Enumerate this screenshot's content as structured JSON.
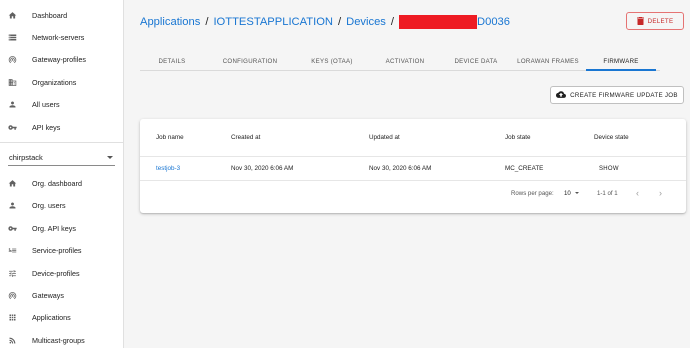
{
  "sidebar": {
    "top_items": [
      {
        "label": "Dashboard",
        "icon": "home-icon"
      },
      {
        "label": "Network-servers",
        "icon": "storage-icon"
      },
      {
        "label": "Gateway-profiles",
        "icon": "wifi-icon"
      },
      {
        "label": "Organizations",
        "icon": "domain-icon"
      },
      {
        "label": "All users",
        "icon": "person-icon"
      },
      {
        "label": "API keys",
        "icon": "key-icon"
      }
    ],
    "org_selector": {
      "value": "chirpstack"
    },
    "org_items": [
      {
        "label": "Org. dashboard",
        "icon": "home-icon"
      },
      {
        "label": "Org. users",
        "icon": "person-icon"
      },
      {
        "label": "Org. API keys",
        "icon": "key-icon"
      },
      {
        "label": "Service-profiles",
        "icon": "account-details-icon"
      },
      {
        "label": "Device-profiles",
        "icon": "tune-icon"
      },
      {
        "label": "Gateways",
        "icon": "wifi-icon"
      },
      {
        "label": "Applications",
        "icon": "apps-icon"
      },
      {
        "label": "Multicast-groups",
        "icon": "rss-icon"
      }
    ]
  },
  "breadcrumb": {
    "applications": "Applications",
    "application_name": "IOTTESTAPPLICATION",
    "devices": "Devices",
    "device_suffix": "D0036",
    "separator": "/"
  },
  "actions": {
    "delete_label": "DELETE",
    "create_fw_label": "CREATE FIRMWARE UPDATE JOB"
  },
  "tabs": [
    {
      "label": "DETAILS"
    },
    {
      "label": "CONFIGURATION"
    },
    {
      "label": "KEYS (OTAA)"
    },
    {
      "label": "ACTIVATION"
    },
    {
      "label": "DEVICE DATA"
    },
    {
      "label": "LORAWAN FRAMES"
    },
    {
      "label": "FIRMWARE",
      "active": true
    }
  ],
  "table": {
    "columns": [
      "Job name",
      "Created at",
      "Updated at",
      "Job state",
      "Device state"
    ],
    "rows": [
      {
        "job_name": "testjob-3",
        "created_at": "Nov 30, 2020 6:06 AM",
        "updated_at": "Nov 30, 2020 6:06 AM",
        "job_state": "MC_CREATE",
        "device_state": "SHOW"
      }
    ]
  },
  "pagination": {
    "rows_per_page_label": "Rows per page:",
    "rows_per_page": "10",
    "range": "1-1 of 1"
  },
  "colors": {
    "accent": "#1976d2",
    "danger": "#c62828",
    "redaction": "#ee1b23"
  }
}
